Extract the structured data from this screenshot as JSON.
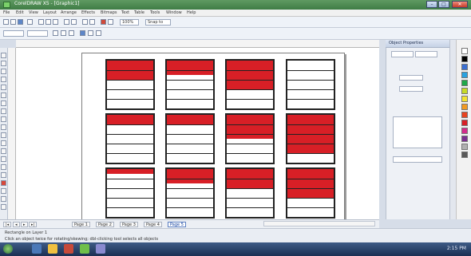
{
  "window": {
    "title": "CorelDRAW X5 - [Graphic1]"
  },
  "menu": [
    "File",
    "Edit",
    "View",
    "Layout",
    "Arrange",
    "Effects",
    "Bitmaps",
    "Text",
    "Table",
    "Tools",
    "Window",
    "Help"
  ],
  "toolbar": {
    "zoom_value": "100%",
    "snap_label": "Snap to"
  },
  "docker": {
    "title": "Object Properties"
  },
  "page_tabs": [
    "Page 1",
    "Page 2",
    "Page 3",
    "Page 4",
    "Page 5"
  ],
  "active_page_index": 4,
  "status": {
    "left": "Rectangle on Layer 1",
    "right": "Click an object twice for rotating/skewing; dbl-clicking tool selects all objects"
  },
  "taskbar": {
    "time": "2:15 PM"
  },
  "colors": {
    "fill_red": "#d81f26",
    "outline": "#222222"
  },
  "artboard": {
    "row_count": 5,
    "boxes": [
      {
        "filled_rows": 2
      },
      {
        "filled_rows": 1.5
      },
      {
        "filled_rows": 3
      },
      {
        "filled_rows": 0
      },
      {
        "filled_rows": 1
      },
      {
        "filled_rows": 1
      },
      {
        "filled_rows": 2.5
      },
      {
        "filled_rows": 4
      },
      {
        "filled_rows": 0.5
      },
      {
        "filled_rows": 1.5
      },
      {
        "filled_rows": 2
      },
      {
        "filled_rows": 3
      }
    ]
  }
}
